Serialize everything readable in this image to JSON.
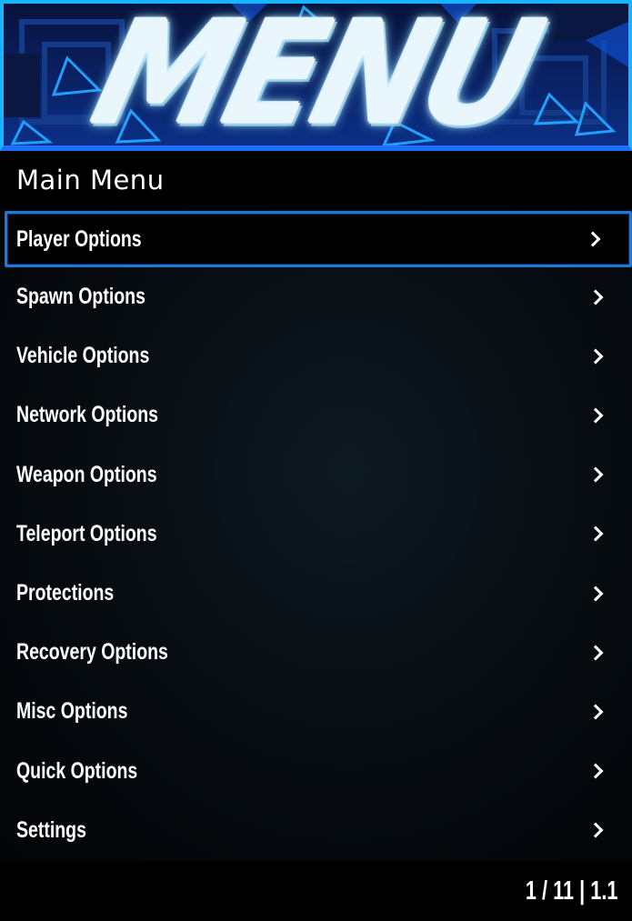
{
  "banner": {
    "title": "MENU",
    "accent_color": "#17b4ff"
  },
  "subtitle": "Main Menu",
  "options": [
    {
      "label": "Player Options",
      "icon": "chevron-right-icon"
    },
    {
      "label": "Spawn Options",
      "icon": "chevron-right-icon"
    },
    {
      "label": "Vehicle Options",
      "icon": "chevron-right-icon"
    },
    {
      "label": "Network Options",
      "icon": "chevron-right-icon"
    },
    {
      "label": "Weapon Options",
      "icon": "chevron-right-icon"
    },
    {
      "label": "Teleport Options",
      "icon": "chevron-right-icon"
    },
    {
      "label": "Protections",
      "icon": "chevron-right-icon"
    },
    {
      "label": "Recovery Options",
      "icon": "chevron-right-icon"
    },
    {
      "label": "Misc Options",
      "icon": "chevron-right-icon"
    },
    {
      "label": "Quick Options",
      "icon": "chevron-right-icon"
    },
    {
      "label": "Settings",
      "icon": "chevron-right-icon"
    }
  ],
  "selected_index": 0,
  "footer": {
    "position": "1 / 11",
    "version": "1.1",
    "text": "1 / 11 | 1.1"
  }
}
